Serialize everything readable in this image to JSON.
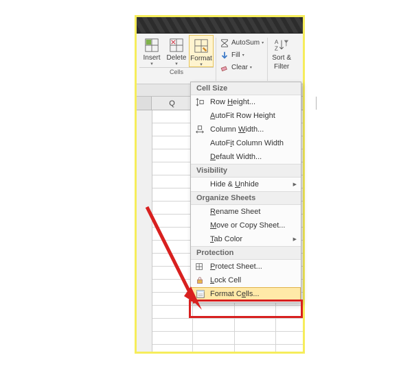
{
  "ribbon": {
    "insert": "Insert",
    "delete": "Delete",
    "format": "Format",
    "cells_group": "Cells",
    "autosum": "AutoSum",
    "fill": "Fill",
    "clear": "Clear",
    "sort_filter_line1": "Sort &",
    "sort_filter_line2": "Filter"
  },
  "column_letter": "Q",
  "menu": {
    "section_cell_size": "Cell Size",
    "row_height": "Row Height...",
    "autofit_row_height": "AutoFit Row Height",
    "column_width": "Column Width...",
    "autofit_column_width": "AutoFit Column Width",
    "default_width": "Default Width...",
    "section_visibility": "Visibility",
    "hide_unhide": "Hide & Unhide",
    "section_organize": "Organize Sheets",
    "rename_sheet": "Rename Sheet",
    "move_or_copy": "Move or Copy Sheet...",
    "tab_color": "Tab Color",
    "section_protection": "Protection",
    "protect_sheet": "Protect Sheet...",
    "lock_cell": "Lock Cell",
    "format_cells": "Format Cells..."
  }
}
